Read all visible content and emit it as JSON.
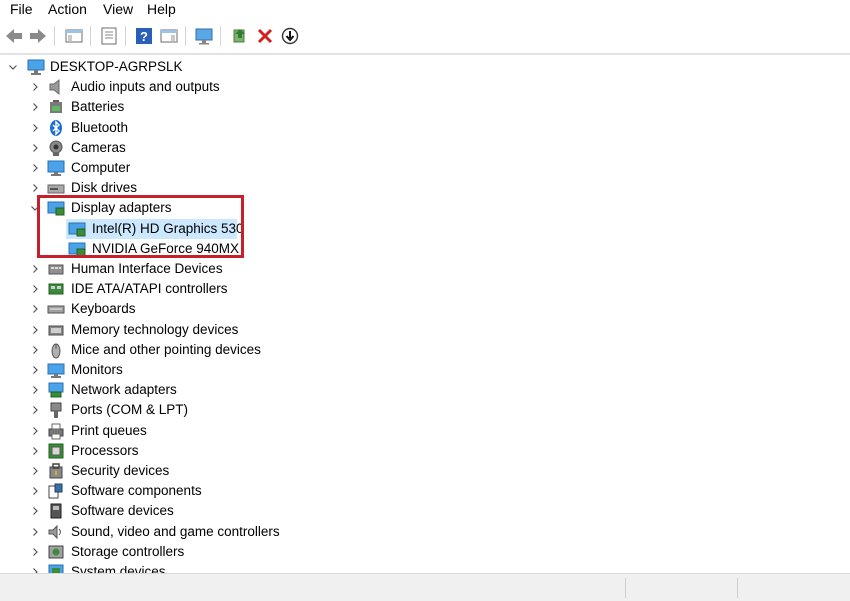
{
  "menu": [
    "File",
    "Action",
    "View",
    "Help"
  ],
  "tree": {
    "root": "DESKTOP-AGRPSLK",
    "categories": [
      {
        "label": "Audio inputs and outputs",
        "icon": "speaker-icon"
      },
      {
        "label": "Batteries",
        "icon": "battery-icon"
      },
      {
        "label": "Bluetooth",
        "icon": "bluetooth-icon"
      },
      {
        "label": "Cameras",
        "icon": "camera-icon"
      },
      {
        "label": "Computer",
        "icon": "computer-icon"
      },
      {
        "label": "Disk drives",
        "icon": "disk-drive-icon"
      },
      {
        "label": "Display adapters",
        "icon": "display-adapter-icon",
        "expanded": true,
        "children": [
          "Intel(R) HD Graphics 530",
          "NVIDIA GeForce 940MX"
        ]
      },
      {
        "label": "Human Interface Devices",
        "icon": "hid-icon"
      },
      {
        "label": "IDE ATA/ATAPI controllers",
        "icon": "ide-controller-icon"
      },
      {
        "label": "Keyboards",
        "icon": "keyboard-icon"
      },
      {
        "label": "Memory technology devices",
        "icon": "memory-icon"
      },
      {
        "label": "Mice and other pointing devices",
        "icon": "mouse-icon"
      },
      {
        "label": "Monitors",
        "icon": "monitor-icon"
      },
      {
        "label": "Network adapters",
        "icon": "network-adapter-icon"
      },
      {
        "label": "Ports (COM & LPT)",
        "icon": "port-icon"
      },
      {
        "label": "Print queues",
        "icon": "printer-icon"
      },
      {
        "label": "Processors",
        "icon": "processor-icon"
      },
      {
        "label": "Security devices",
        "icon": "security-icon"
      },
      {
        "label": "Software components",
        "icon": "software-component-icon"
      },
      {
        "label": "Software devices",
        "icon": "software-device-icon"
      },
      {
        "label": "Sound, video and game controllers",
        "icon": "sound-icon"
      },
      {
        "label": "Storage controllers",
        "icon": "storage-icon"
      },
      {
        "label": "System devices",
        "icon": "system-device-icon"
      }
    ]
  },
  "colors": {
    "highlight_border": "#c8202b",
    "selection": "#cce8ff",
    "tree_icon_blue": "#1e88d8"
  }
}
